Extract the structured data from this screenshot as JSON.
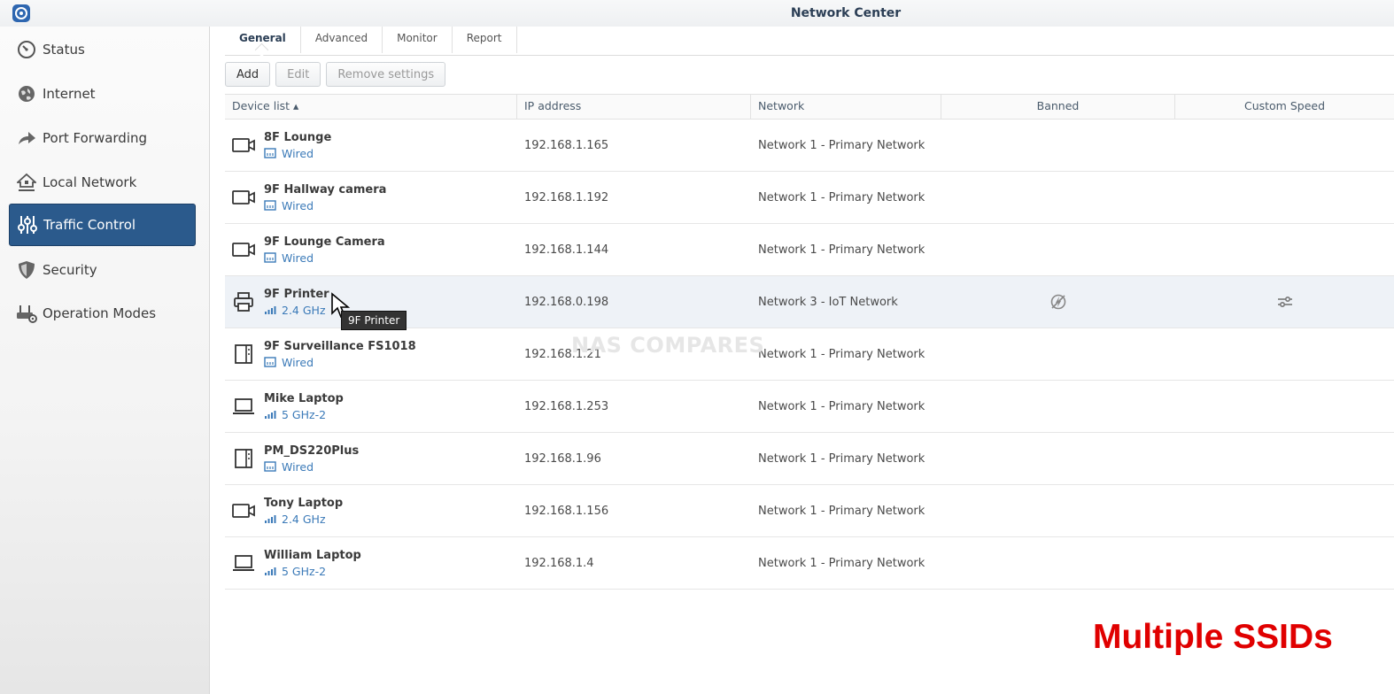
{
  "window": {
    "title": "Network Center"
  },
  "sidebar": {
    "items": [
      {
        "label": "Status",
        "icon": "gauge-icon"
      },
      {
        "label": "Internet",
        "icon": "globe-icon"
      },
      {
        "label": "Port Forwarding",
        "icon": "forward-arrow-icon"
      },
      {
        "label": "Local Network",
        "icon": "home-network-icon"
      },
      {
        "label": "Traffic Control",
        "icon": "sliders-icon",
        "active": true
      },
      {
        "label": "Security",
        "icon": "shield-icon"
      },
      {
        "label": "Operation Modes",
        "icon": "router-gear-icon"
      }
    ]
  },
  "tabs": [
    "General",
    "Advanced",
    "Monitor",
    "Report"
  ],
  "toolbar": {
    "add": "Add",
    "edit": "Edit",
    "remove": "Remove settings"
  },
  "table": {
    "headers": [
      "Device list ▴",
      "IP address",
      "Network",
      "Banned",
      "Custom Speed"
    ],
    "rows": [
      {
        "name": "8F Lounge",
        "conn": "Wired",
        "ip": "192.168.1.165",
        "network": "Network 1 - Primary Network",
        "device": "camera",
        "conn_type": "wired"
      },
      {
        "name": "9F Hallway camera",
        "conn": "Wired",
        "ip": "192.168.1.192",
        "network": "Network 1 - Primary Network",
        "device": "camera",
        "conn_type": "wired"
      },
      {
        "name": "9F Lounge Camera",
        "conn": "Wired",
        "ip": "192.168.1.144",
        "network": "Network 1 - Primary Network",
        "device": "camera",
        "conn_type": "wired"
      },
      {
        "name": "9F Printer",
        "conn": "2.4 GHz",
        "ip": "192.168.0.198",
        "network": "Network 3 - IoT Network",
        "device": "printer",
        "conn_type": "wifi"
      },
      {
        "name": "9F Surveillance FS1018",
        "conn": "Wired",
        "ip": "192.168.1.21",
        "network": "Network 1 - Primary Network",
        "device": "nas",
        "conn_type": "wired"
      },
      {
        "name": "Mike Laptop",
        "conn": "5 GHz-2",
        "ip": "192.168.1.253",
        "network": "Network 1 - Primary Network",
        "device": "laptop",
        "conn_type": "wifi"
      },
      {
        "name": "PM_DS220Plus",
        "conn": "Wired",
        "ip": "192.168.1.96",
        "network": "Network 1 - Primary Network",
        "device": "nas",
        "conn_type": "wired"
      },
      {
        "name": "Tony Laptop",
        "conn": "2.4 GHz",
        "ip": "192.168.1.156",
        "network": "Network 1 - Primary Network",
        "device": "camera",
        "conn_type": "wifi"
      },
      {
        "name": "William Laptop",
        "conn": "5 GHz-2",
        "ip": "192.168.1.4",
        "network": "Network 1 - Primary Network",
        "device": "laptop",
        "conn_type": "wifi"
      }
    ]
  },
  "tooltip": "9F Printer",
  "watermark": "NAS COMPARES",
  "overlay_text": "Multiple SSIDs",
  "colors": {
    "accent": "#2b5a8c",
    "link": "#3b7ab8",
    "overlay": "#e00000"
  }
}
